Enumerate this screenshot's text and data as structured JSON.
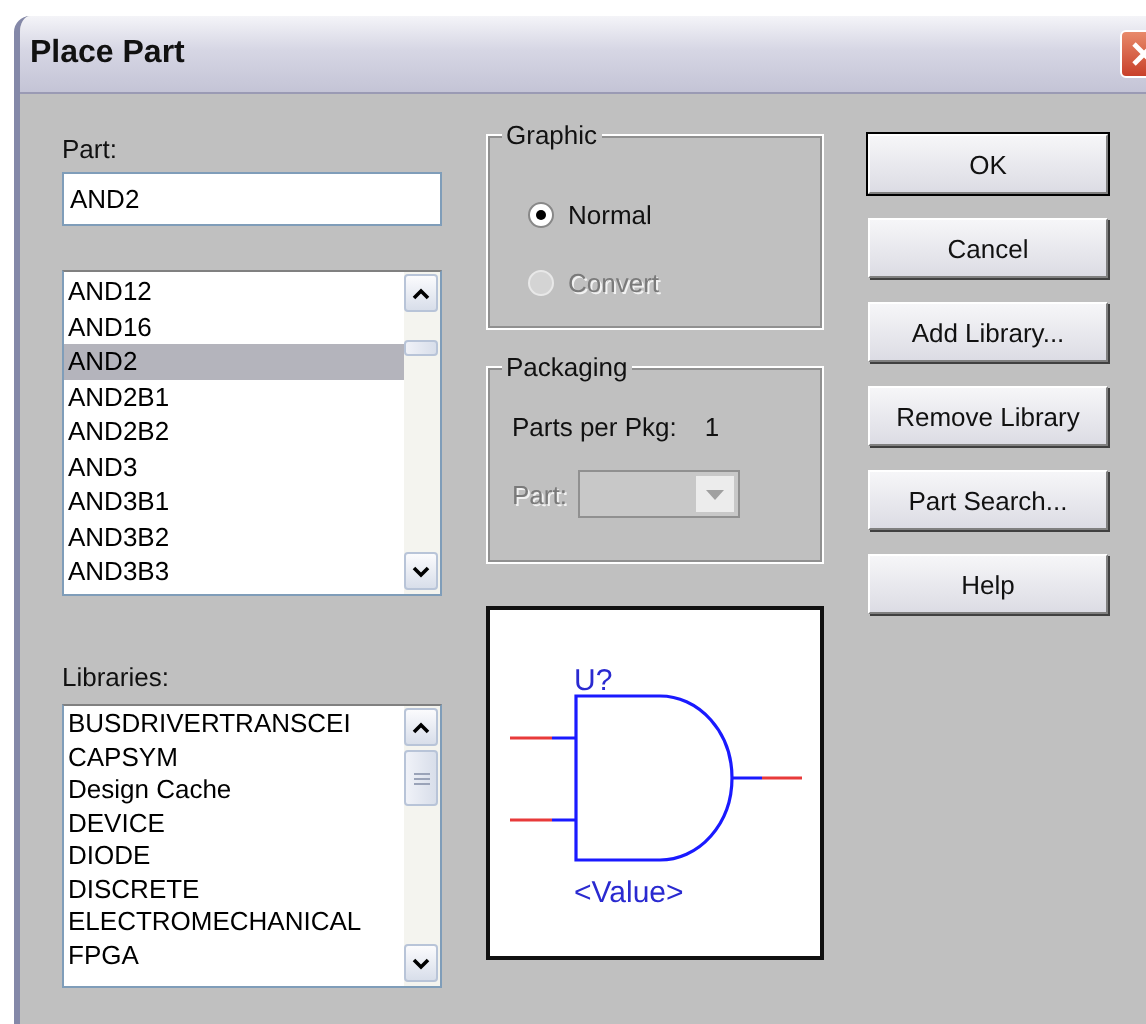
{
  "window": {
    "title": "Place Part"
  },
  "part": {
    "label": "Part:",
    "value": "AND2"
  },
  "parts_list": {
    "items": [
      {
        "label": "AND12",
        "selected": false
      },
      {
        "label": "AND16",
        "selected": false
      },
      {
        "label": "AND2",
        "selected": true
      },
      {
        "label": "AND2B1",
        "selected": false
      },
      {
        "label": "AND2B2",
        "selected": false
      },
      {
        "label": "AND3",
        "selected": false
      },
      {
        "label": "AND3B1",
        "selected": false
      },
      {
        "label": "AND3B2",
        "selected": false
      },
      {
        "label": "AND3B3",
        "selected": false
      }
    ]
  },
  "libraries": {
    "label": "Libraries:",
    "items": [
      {
        "label": "BUSDRIVERTRANSCEI",
        "selected": false
      },
      {
        "label": "CAPSYM",
        "selected": false
      },
      {
        "label": "Design Cache",
        "selected": false
      },
      {
        "label": "DEVICE",
        "selected": false
      },
      {
        "label": "DIODE",
        "selected": false
      },
      {
        "label": "DISCRETE",
        "selected": false
      },
      {
        "label": "ELECTROMECHANICAL",
        "selected": false
      },
      {
        "label": "FPGA",
        "selected": false
      }
    ]
  },
  "graphic": {
    "title": "Graphic",
    "options": [
      {
        "label": "Normal",
        "selected": true,
        "disabled": false
      },
      {
        "label": "Convert",
        "selected": false,
        "disabled": true
      }
    ]
  },
  "packaging": {
    "title": "Packaging",
    "parts_per_pkg_label": "Parts per Pkg:",
    "parts_per_pkg_value": "1",
    "part_label": "Part:",
    "part_disabled": true
  },
  "preview": {
    "reference": "U?",
    "value": "<Value>"
  },
  "buttons": [
    {
      "label": "OK",
      "default": true
    },
    {
      "label": "Cancel",
      "default": false
    },
    {
      "label": "Add Library...",
      "default": false
    },
    {
      "label": "Remove Library",
      "default": false
    },
    {
      "label": "Part Search...",
      "default": false
    },
    {
      "label": "Help",
      "default": false
    }
  ]
}
